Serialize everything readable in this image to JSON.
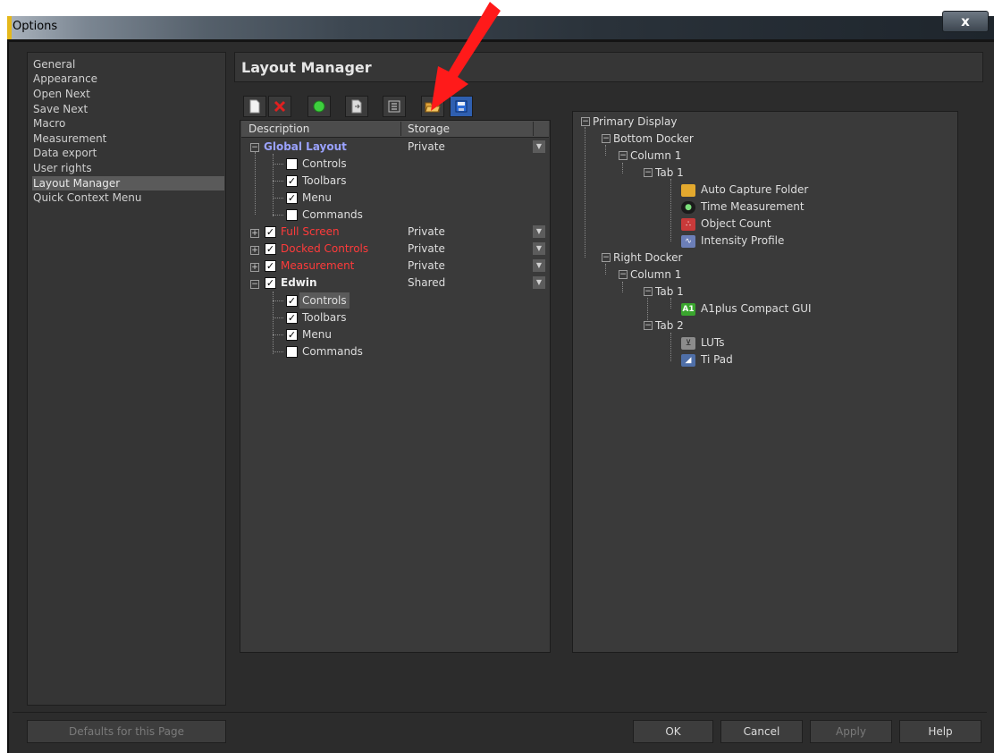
{
  "window": {
    "title": "Options",
    "close_label": "x"
  },
  "sidebar": {
    "items": [
      {
        "label": "General"
      },
      {
        "label": "Appearance"
      },
      {
        "label": "Open Next"
      },
      {
        "label": "Save Next"
      },
      {
        "label": "Macro"
      },
      {
        "label": "Measurement"
      },
      {
        "label": "Data export"
      },
      {
        "label": "User rights"
      },
      {
        "label": "Layout Manager",
        "selected": true
      },
      {
        "label": "Quick Context Menu"
      }
    ]
  },
  "header": {
    "title": "Layout Manager"
  },
  "toolbar": {
    "icons": [
      "new-layout-icon",
      "delete-icon",
      "activate-icon",
      "copy-icon",
      "tree-view-icon",
      "open-folder-icon",
      "save-icon"
    ]
  },
  "layouts": {
    "columns": {
      "description": "Description",
      "storage": "Storage"
    },
    "rows": [
      {
        "label": "Global Layout",
        "storage": "Private"
      },
      {
        "label": "Controls"
      },
      {
        "label": "Toolbars"
      },
      {
        "label": "Menu"
      },
      {
        "label": "Commands"
      },
      {
        "label": "Full Screen",
        "storage": "Private"
      },
      {
        "label": "Docked Controls",
        "storage": "Private"
      },
      {
        "label": "Measurement",
        "storage": "Private"
      },
      {
        "label": "Edwin",
        "storage": "Shared"
      },
      {
        "label": "Controls"
      },
      {
        "label": "Toolbars"
      },
      {
        "label": "Menu"
      },
      {
        "label": "Commands"
      }
    ]
  },
  "preview": {
    "nodes": [
      {
        "label": "Primary Display"
      },
      {
        "label": "Bottom Docker"
      },
      {
        "label": "Column 1"
      },
      {
        "label": "Tab 1"
      },
      {
        "label": "Auto Capture Folder",
        "icon": "folder-icon"
      },
      {
        "label": "Time Measurement",
        "icon": "clock-icon"
      },
      {
        "label": "Object Count",
        "icon": "object-count-icon"
      },
      {
        "label": "Intensity Profile",
        "icon": "intensity-profile-icon"
      },
      {
        "label": "Right Docker"
      },
      {
        "label": "Column 1"
      },
      {
        "label": "Tab 1"
      },
      {
        "label": "A1plus Compact GUI",
        "icon": "a1-icon",
        "icon_text": "A1"
      },
      {
        "label": "Tab 2"
      },
      {
        "label": "LUTs",
        "icon": "luts-icon"
      },
      {
        "label": "Ti Pad",
        "icon": "ti-pad-icon"
      }
    ]
  },
  "footer": {
    "defaults_label": "Defaults for this Page",
    "ok_label": "OK",
    "cancel_label": "Cancel",
    "apply_label": "Apply",
    "help_label": "Help"
  },
  "colors": {
    "selected_layout": "#9aa2ff",
    "inactive_layout": "#ff3a3a",
    "annotation_arrow": "#ff1a1a"
  }
}
